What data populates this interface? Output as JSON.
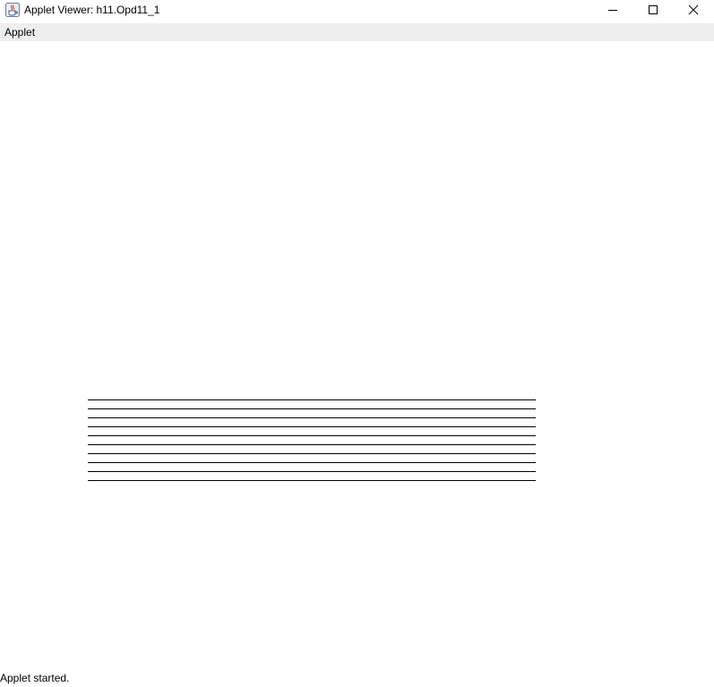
{
  "window": {
    "title": "Applet Viewer: h11.Opd11_1",
    "icon": "java-cup-icon",
    "controls": {
      "minimize_icon": "minimize-icon",
      "maximize_icon": "maximize-icon",
      "close_icon": "close-icon"
    }
  },
  "menubar": {
    "items": [
      {
        "label": "Applet"
      }
    ]
  },
  "applet": {
    "drawing": {
      "shape": "horizontal-lines",
      "line_count": 10,
      "line_color": "#000000"
    }
  },
  "statusbar": {
    "text": "Applet started."
  }
}
